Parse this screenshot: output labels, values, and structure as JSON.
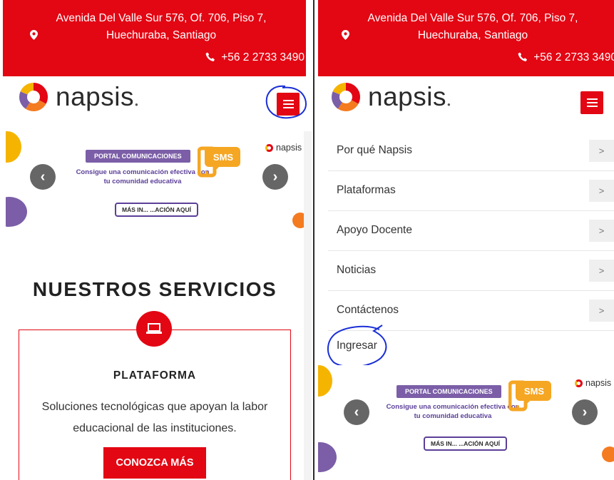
{
  "header": {
    "address": "Avenida Del Valle Sur 576, Of. 706, Piso 7, Huechuraba, Santiago",
    "phone": "+56 2 2733 3490"
  },
  "logo": {
    "name": "napsis"
  },
  "banner": {
    "label": "PORTAL COMUNICACIONES",
    "subtitle": "Consigue una comunicación efectiva con tu comunidad educativa",
    "button": "MÁS IN... ...ACIÓN AQUÍ",
    "badge": "SMS",
    "brand": "napsis"
  },
  "services": {
    "title": "NUESTROS SERVICIOS",
    "card_title": "PLATAFORMA",
    "card_text": "Soluciones tecnológicas que apoyan la labor educacional de las instituciones.",
    "card_button": "CONOZCA MÁS"
  },
  "menu": {
    "items": [
      {
        "label": "Por qué Napsis"
      },
      {
        "label": "Plataformas"
      },
      {
        "label": "Apoyo Docente"
      },
      {
        "label": "Noticias"
      },
      {
        "label": "Contáctenos"
      }
    ],
    "login": "Ingresar",
    "arrow": ">"
  },
  "icons": {
    "pin": "location-pin-icon",
    "phone": "phone-icon",
    "menu": "hamburger-menu-icon",
    "laptop": "laptop-icon",
    "prev": "chevron-left-icon",
    "next": "chevron-right-icon"
  },
  "colors": {
    "brand_red": "#e30613",
    "purple": "#7b5ea7",
    "annotation": "#1a2fd6"
  }
}
